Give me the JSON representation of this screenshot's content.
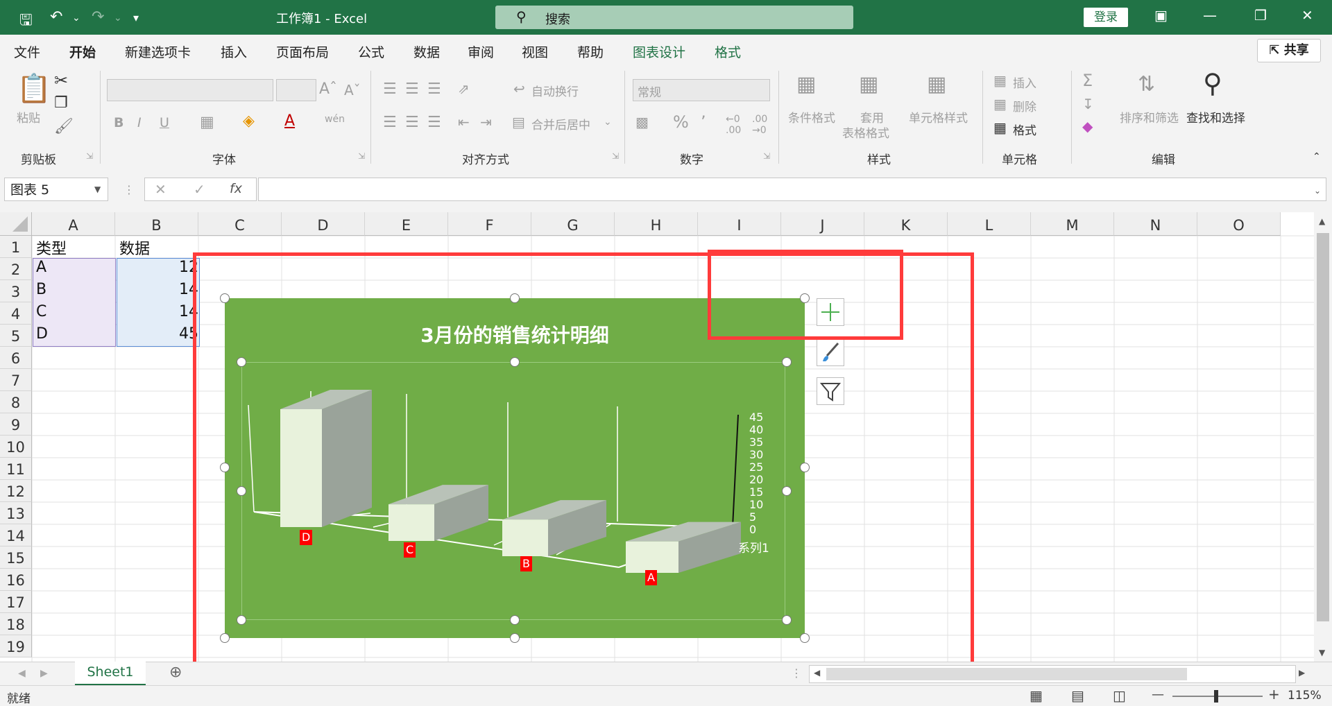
{
  "titlebar": {
    "title": "工作簿1  -  Excel",
    "search_placeholder": "搜索",
    "login_label": "登录"
  },
  "menu": [
    {
      "label": "文件"
    },
    {
      "label": "开始"
    },
    {
      "label": "新建选项卡"
    },
    {
      "label": "插入"
    },
    {
      "label": "页面布局"
    },
    {
      "label": "公式"
    },
    {
      "label": "数据"
    },
    {
      "label": "审阅"
    },
    {
      "label": "视图"
    },
    {
      "label": "帮助"
    },
    {
      "label": "图表设计"
    },
    {
      "label": "格式"
    }
  ],
  "share_label": "共享",
  "ribbon": {
    "clipboard": {
      "label": "剪贴板",
      "paste": "粘贴"
    },
    "font": {
      "label": "字体",
      "bold": "B",
      "italic": "I",
      "underline": "U"
    },
    "alignment": {
      "label": "对齐方式",
      "wrap": "自动换行",
      "merge": "合并后居中"
    },
    "number": {
      "label": "数字",
      "format": "常规"
    },
    "styles": {
      "label": "样式",
      "conditional": "条件格式",
      "table_line1": "套用",
      "table_line2": "表格格式",
      "cell_styles": "单元格样式"
    },
    "cells": {
      "label": "单元格",
      "insert": "插入",
      "delete": "删除",
      "format": "格式"
    },
    "editing": {
      "label": "编辑",
      "sort": "排序和筛选",
      "find": "查找和选择"
    }
  },
  "formula_bar": {
    "name_box": "图表 5",
    "fx": "fx",
    "value": ""
  },
  "columns": [
    "A",
    "B",
    "C",
    "D",
    "E",
    "F",
    "G",
    "H",
    "I",
    "J",
    "K",
    "L",
    "M",
    "N",
    "O"
  ],
  "rows": [
    "1",
    "2",
    "3",
    "4",
    "5",
    "6",
    "7",
    "8",
    "9",
    "10",
    "11",
    "12",
    "13",
    "14",
    "15",
    "16",
    "17",
    "18",
    "19"
  ],
  "cells": {
    "A1": "类型",
    "B1": "数据",
    "A2": "A",
    "B2": "12",
    "A3": "B",
    "B3": "14",
    "A4": "C",
    "B4": "14",
    "A5": "D",
    "B5": "45"
  },
  "chart_data": {
    "type": "bar",
    "title": "3月份的销售统计明细",
    "categories": [
      "D",
      "C",
      "B",
      "A"
    ],
    "series": [
      {
        "name": "系列1",
        "values": [
          45,
          14,
          14,
          12
        ]
      }
    ],
    "yticks": [
      "45",
      "40",
      "35",
      "30",
      "25",
      "20",
      "15",
      "10",
      "5",
      "0"
    ],
    "ylim": [
      0,
      45
    ],
    "background": "#70ad47",
    "category_label_color": "#ff0000"
  },
  "sheet_tab": "Sheet1",
  "status": {
    "ready": "就绪",
    "zoom": "115%"
  }
}
